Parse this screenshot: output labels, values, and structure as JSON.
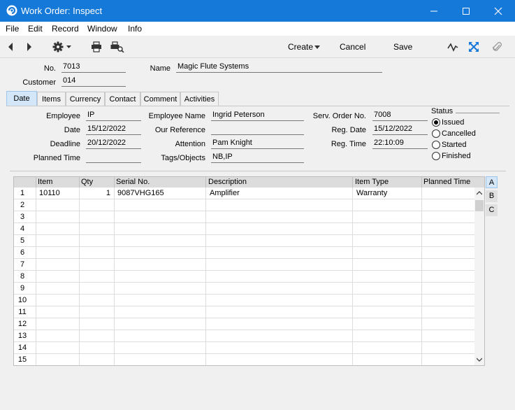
{
  "window": {
    "title": "Work Order: Inspect"
  },
  "menu": {
    "file": "File",
    "edit": "Edit",
    "record": "Record",
    "window": "Window",
    "info": "Info"
  },
  "toolbar": {
    "create": "Create",
    "cancel": "Cancel",
    "save": "Save"
  },
  "header": {
    "no_label": "No.",
    "no_value": "7013",
    "name_label": "Name",
    "name_value": "Magic Flute Systems",
    "customer_label": "Customer",
    "customer_value": "014"
  },
  "tabs": [
    "Date",
    "Items",
    "Currency",
    "Contact",
    "Comment",
    "Activities"
  ],
  "date_tab": {
    "employee_label": "Employee",
    "employee_value": "IP",
    "date_label": "Date",
    "date_value": "15/12/2022",
    "deadline_label": "Deadline",
    "deadline_value": "20/12/2022",
    "planned_time_label": "Planned Time",
    "planned_time_value": "",
    "employee_name_label": "Employee Name",
    "employee_name_value": "Ingrid Peterson",
    "our_reference_label": "Our Reference",
    "our_reference_value": "",
    "attention_label": "Attention",
    "attention_value": "Pam Knight",
    "tags_label": "Tags/Objects",
    "tags_value": "NB,IP",
    "serv_order_label": "Serv. Order No.",
    "serv_order_value": "7008",
    "reg_date_label": "Reg. Date",
    "reg_date_value": "15/12/2022",
    "reg_time_label": "Reg. Time",
    "reg_time_value": "22:10:09"
  },
  "status": {
    "title": "Status",
    "options": [
      "Issued",
      "Cancelled",
      "Started",
      "Finished"
    ],
    "selected": "Issued"
  },
  "grid": {
    "columns": [
      "Item",
      "Qty",
      "Serial No.",
      "Description",
      "Item Type",
      "Planned Time"
    ],
    "row_numbers": [
      "1",
      "2",
      "3",
      "4",
      "5",
      "6",
      "7",
      "8",
      "9",
      "10",
      "11",
      "12",
      "13",
      "14",
      "15"
    ],
    "rows": [
      {
        "item": "10110",
        "qty": "1",
        "serial": "9087VHG165",
        "description": "Amplifier",
        "item_type": "Warranty",
        "planned_time": ""
      }
    ],
    "side_tabs": [
      "A",
      "B",
      "C"
    ]
  }
}
